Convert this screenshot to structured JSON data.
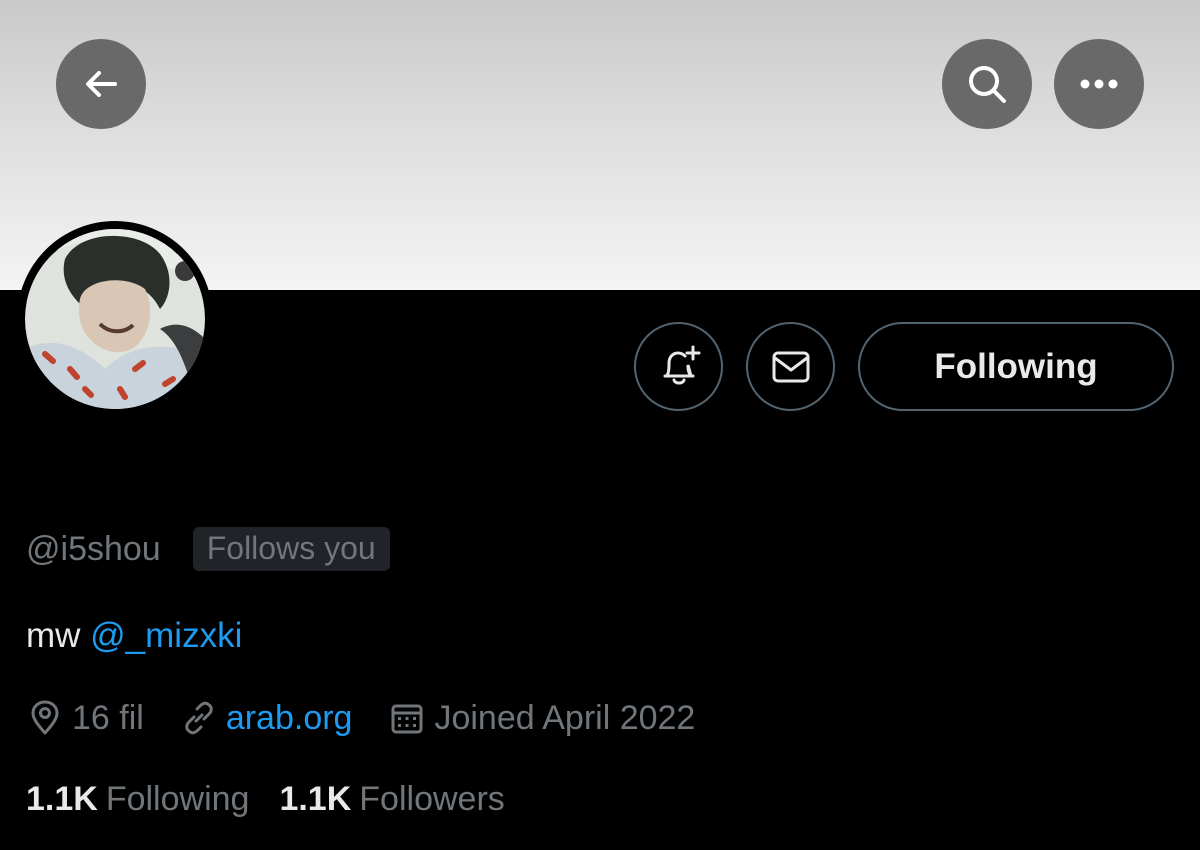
{
  "profile": {
    "handle": "@i5shou",
    "follows_you_badge": "Follows you",
    "bio_text": "mw ",
    "bio_mention": "@_mizxki",
    "location": "16 fil",
    "website": "arab.org",
    "joined": "Joined April 2022"
  },
  "actions": {
    "following_label": "Following"
  },
  "stats": {
    "following_count": "1.1K",
    "following_label": "Following",
    "followers_count": "1.1K",
    "followers_label": "Followers"
  },
  "icons": {
    "back": "arrow-left-icon",
    "search": "search-icon",
    "more": "more-dots-icon",
    "notify": "bell-plus-icon",
    "message": "envelope-icon",
    "location": "location-pin-icon",
    "link": "link-icon",
    "calendar": "calendar-icon"
  },
  "colors": {
    "background": "#000000",
    "accent": "#1d9bf0",
    "muted_text": "#71767b",
    "primary_text": "#e7e9ea",
    "border": "#536471",
    "badge_bg": "#202327"
  }
}
